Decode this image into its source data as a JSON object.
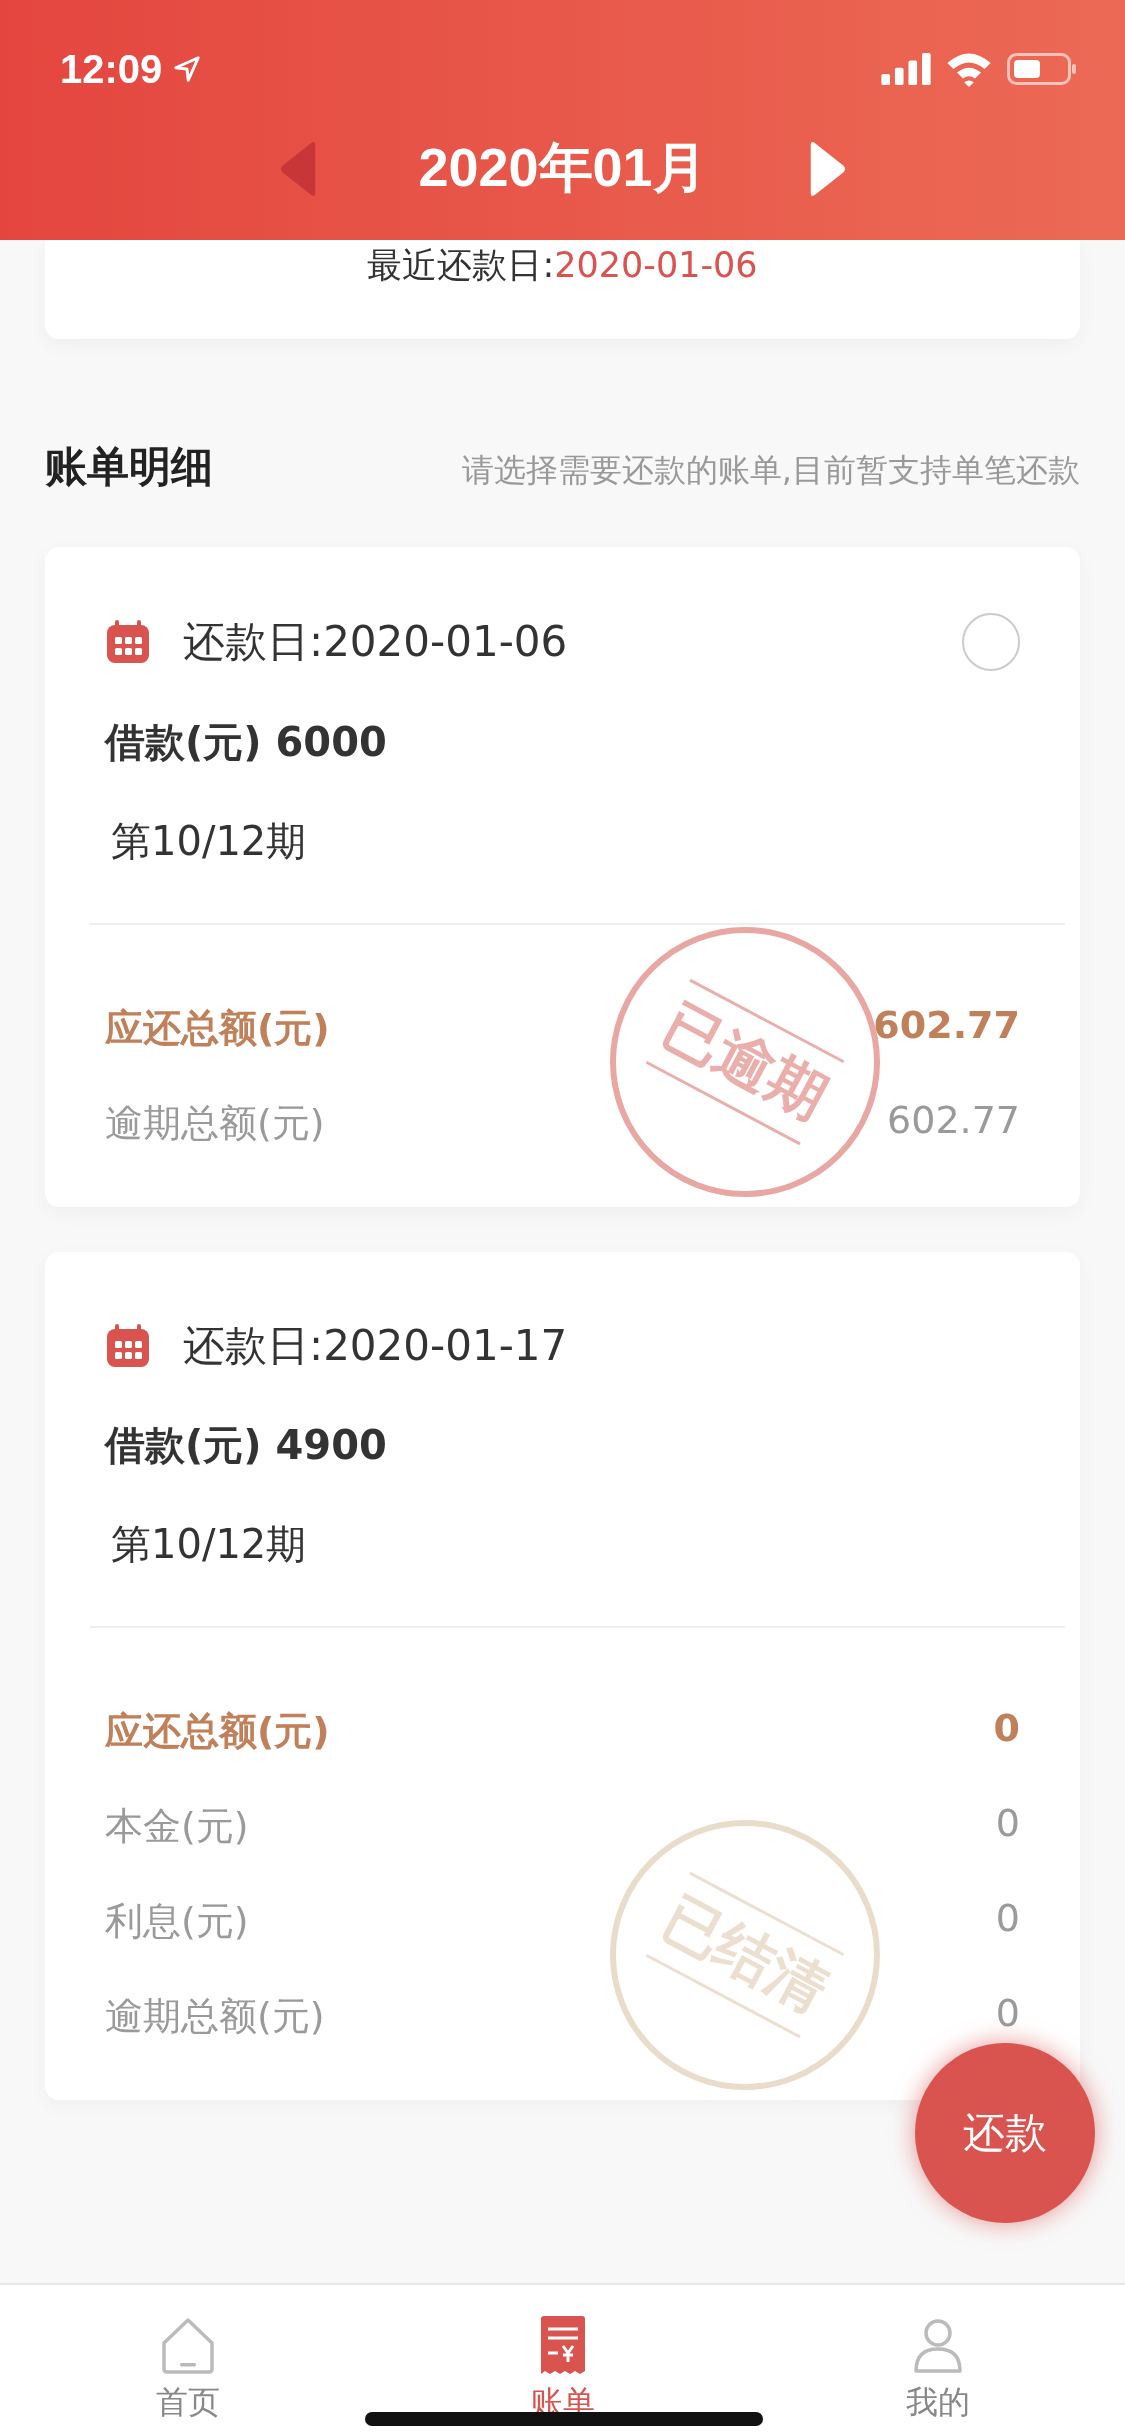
{
  "status_bar": {
    "time": "12:09"
  },
  "header": {
    "title": "2020年01月"
  },
  "summary": {
    "label": "最近还款日:",
    "value": "2020-01-06"
  },
  "section": {
    "title": "账单明细",
    "hint": "请选择需要还款的账单,目前暂支持单笔还款"
  },
  "cards": [
    {
      "due": "还款日:2020-01-06",
      "loan": "借款(元) 6000",
      "period": "第10/12期",
      "radio": {
        "selected": false
      },
      "stamp": {
        "kind": "overdue",
        "text": "已逾期"
      },
      "rows": [
        {
          "kind": "total",
          "label": "应还总额(元)",
          "value": "602.77"
        },
        {
          "kind": "detail",
          "label": "逾期总额(元)",
          "value": "602.77"
        }
      ]
    },
    {
      "due": "还款日:2020-01-17",
      "loan": "借款(元) 4900",
      "period": "第10/12期",
      "stamp": {
        "kind": "settled",
        "text": "已结清"
      },
      "rows": [
        {
          "kind": "total",
          "label": "应还总额(元)",
          "value": "0"
        },
        {
          "kind": "detail",
          "label": "本金(元)",
          "value": "0"
        },
        {
          "kind": "detail",
          "label": "利息(元)",
          "value": "0"
        },
        {
          "kind": "detail",
          "label": "逾期总额(元)",
          "value": "0"
        }
      ]
    }
  ],
  "fab": {
    "label": "还款"
  },
  "tabs": [
    {
      "kind": "home",
      "label": "首页",
      "selected": false
    },
    {
      "kind": "bill",
      "label": "账单",
      "selected": true
    },
    {
      "kind": "me",
      "label": "我的",
      "selected": false
    }
  ]
}
